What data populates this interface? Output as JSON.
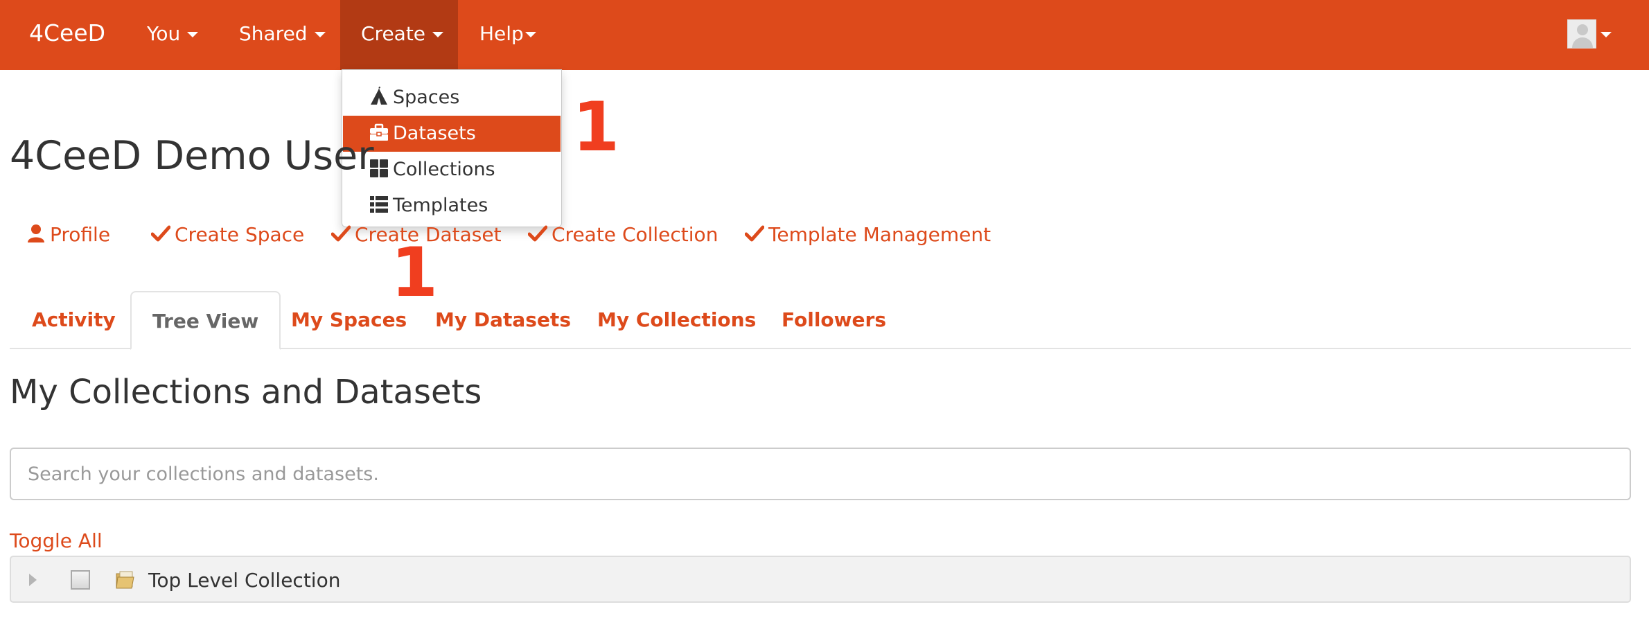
{
  "colors": {
    "brand": "#dd4a1b",
    "brand_dark": "#b23a14",
    "annotation": "#f03e1f"
  },
  "navbar": {
    "brand": "4CeeD",
    "menu": {
      "you": "You",
      "shared": "Shared",
      "create": "Create",
      "help": "Help"
    },
    "avatar_icon": "user-avatar-icon"
  },
  "create_menu": {
    "items": [
      {
        "label": "Spaces",
        "icon": "tent-icon"
      },
      {
        "label": "Datasets",
        "icon": "briefcase-icon",
        "active": true
      },
      {
        "label": "Collections",
        "icon": "grid-icon"
      },
      {
        "label": "Templates",
        "icon": "list-icon"
      }
    ]
  },
  "annotations": [
    "1",
    "1"
  ],
  "page": {
    "title": "4CeeD Demo User"
  },
  "actions": {
    "profile": "Profile",
    "create_space": "Create Space",
    "create_dataset": "Create Dataset",
    "create_collection": "Create Collection",
    "template_management": "Template Management"
  },
  "tabs": {
    "activity": "Activity",
    "tree_view": "Tree View",
    "my_spaces": "My Spaces",
    "my_datasets": "My Datasets",
    "my_collections": "My Collections",
    "followers": "Followers",
    "active": "Tree View"
  },
  "section": {
    "title": "My Collections and Datasets",
    "search_placeholder": "Search your collections and datasets.",
    "toggle_all": "Toggle All"
  },
  "tree": {
    "items": [
      {
        "label": "Top Level Collection",
        "icon": "folder-icon"
      }
    ]
  }
}
